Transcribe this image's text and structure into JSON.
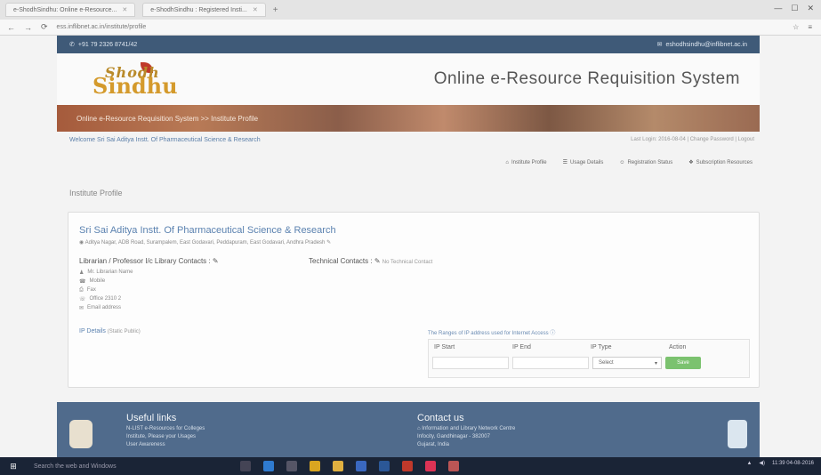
{
  "browser": {
    "tabs": [
      {
        "label": "e-ShodhSindhu: Online e-Resource..."
      },
      {
        "label": "e-ShodhSindhu : Registered Insti..."
      }
    ],
    "url": "ess.inflibnet.ac.in/institute/profile",
    "new_tab_icon": "plus-icon"
  },
  "site": {
    "phone": "+91 79 2326 8741/42",
    "email": "eshodhsindhu@inflibnet.ac.in",
    "logo_text_top": "Shodh",
    "logo_text_main": "Sindhu",
    "system_title": "Online e-Resource Requisition System",
    "breadcrumb": "Online e-Resource Requisition System >> Institute Profile",
    "welcome": "Welcome Sri Sai Aditya Instt. Of Pharmaceutical Science & Research",
    "last_login": "Last Login: 2016-08-04 | Change Password | Logout",
    "subnav": [
      {
        "icon": "home-icon",
        "label": "Institute Profile"
      },
      {
        "icon": "list-icon",
        "label": "Usage Details"
      },
      {
        "icon": "users-icon",
        "label": "Registration Status"
      },
      {
        "icon": "gift-icon",
        "label": "Subscription Resources"
      }
    ],
    "page_heading": "Institute Profile"
  },
  "profile": {
    "inst_name": "Sri Sai Aditya Instt. Of Pharmaceutical Science & Research",
    "address": "Aditya Nagar, ADB Road, Surampalem, East Godavari, Peddapuram, East Godavari, Andhra Pradesh",
    "librarian_heading": "Librarian / Professor I/c Library Contacts :",
    "librarian_lines": [
      {
        "icon": "user-icon",
        "text": "Mr. Librarian Name"
      },
      {
        "icon": "phone-icon",
        "text": "Mobile"
      },
      {
        "icon": "fax-icon",
        "text": "Fax"
      },
      {
        "icon": "phone-alt-icon",
        "text": "Office 2310 2"
      },
      {
        "icon": "mail-icon",
        "text": "Email address"
      }
    ],
    "tech_heading": "Technical Contacts :",
    "tech_sub": "No Technical Contact",
    "ip_label": "IP Details",
    "ip_note": "(Static Public)",
    "ip_range_heading": "The Ranges of IP address used for Internet Access",
    "ip_columns": [
      "IP Start",
      "IP End",
      "IP Type",
      "Action"
    ],
    "ip_start_value": "",
    "ip_end_value": "",
    "ip_type_selected": "Select",
    "ip_save_label": "Save"
  },
  "footer": {
    "useful_heading": "Useful links",
    "useful_links": [
      "N-LIST e-Resources for Colleges",
      "Institute, Please your Usages",
      "User Awareness"
    ],
    "contact_heading": "Contact us",
    "contact_lines": [
      "Information and Library Network Centre",
      "Infocity, Gandhinagar - 382007",
      "Gujarat, India"
    ]
  },
  "taskbar": {
    "search_placeholder": "Search the web and Windows",
    "clock": "11:39",
    "date": "04-08-2016"
  }
}
